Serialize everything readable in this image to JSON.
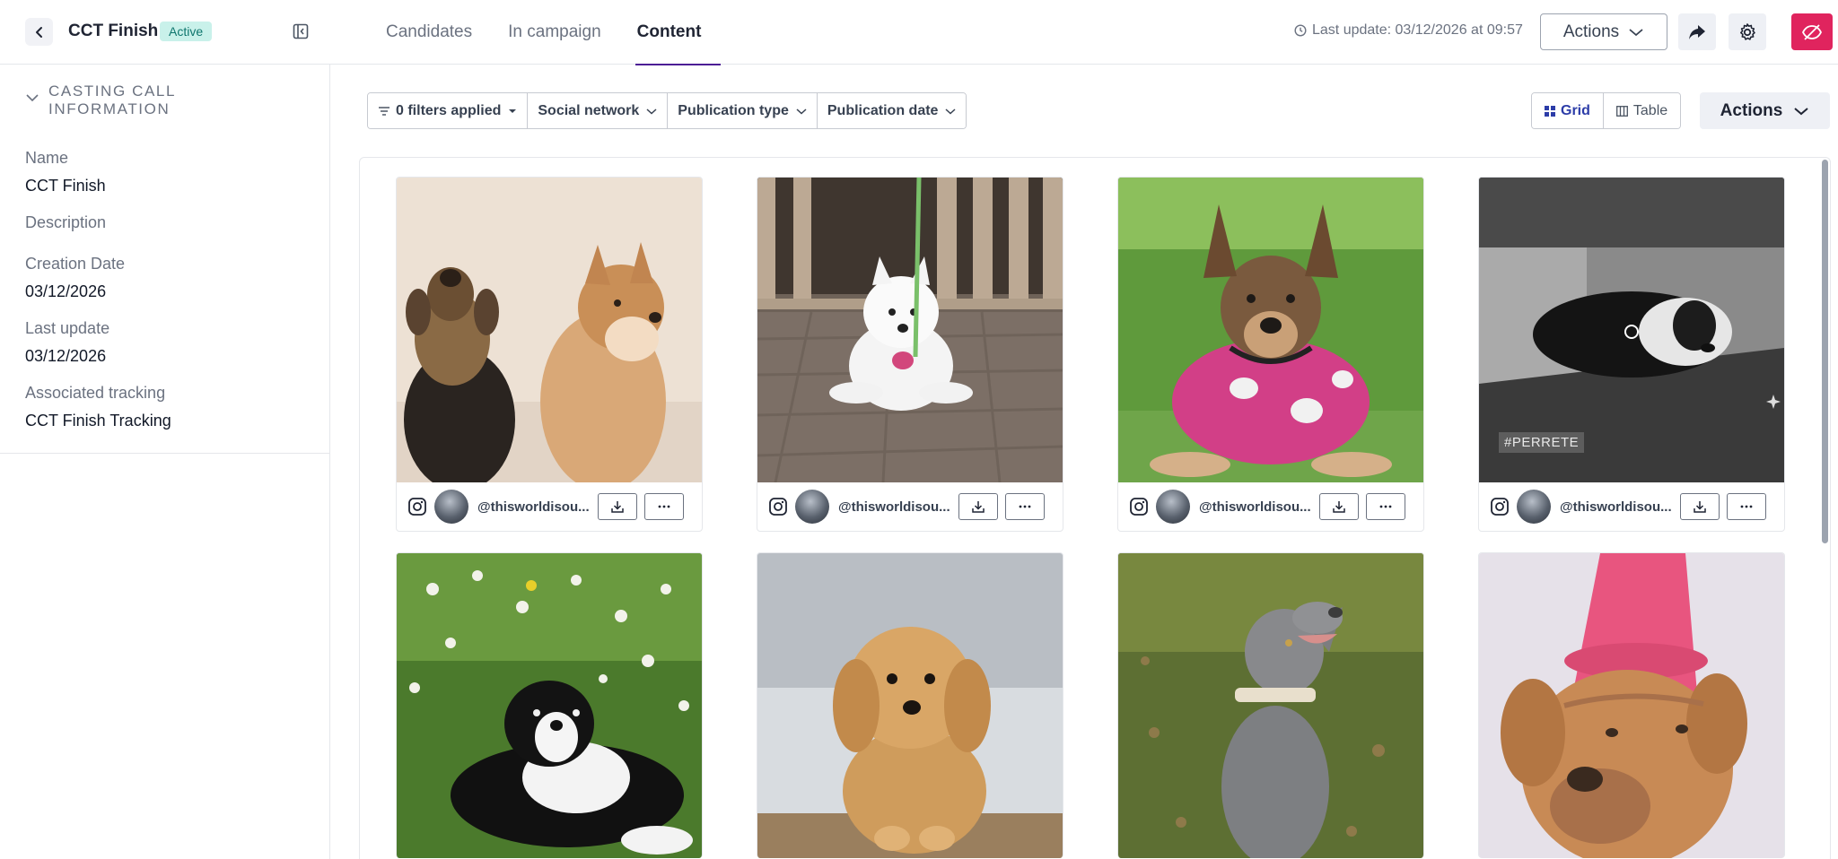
{
  "header": {
    "title": "CCT Finish",
    "status": "Active",
    "tabs": [
      {
        "label": "Candidates"
      },
      {
        "label": "In campaign"
      },
      {
        "label": "Content"
      }
    ],
    "last_update": "Last update: 03/12/2026 at 09:57",
    "actions_label": "Actions",
    "icons": [
      "back-icon",
      "collapse-panel-icon",
      "clock-icon",
      "chevron-down-icon",
      "share-icon",
      "gear-icon",
      "eye-off-icon"
    ],
    "accent_color": "#e0245e"
  },
  "sidebar": {
    "section_title": "CASTING CALL INFORMATION",
    "fields": [
      {
        "label": "Name",
        "value": "CCT Finish"
      },
      {
        "label": "Description",
        "value": ""
      },
      {
        "label": "Creation Date",
        "value": "03/12/2026"
      },
      {
        "label": "Last update",
        "value": "03/12/2026"
      },
      {
        "label": "Associated tracking",
        "value": "CCT Finish Tracking"
      }
    ]
  },
  "toolbar": {
    "filters": [
      "0 filters applied",
      "Social network",
      "Publication type",
      "Publication date"
    ],
    "view_grid": "Grid",
    "view_table": "Table",
    "actions_label": "Actions"
  },
  "content": {
    "cards": [
      {
        "handle": "@thisworldisou...",
        "network": "instagram-icon",
        "image": "two-dogs-photo"
      },
      {
        "handle": "@thisworldisou...",
        "network": "instagram-icon",
        "image": "white-dog-photo"
      },
      {
        "handle": "@thisworldisou...",
        "network": "instagram-icon",
        "image": "dog-pink-shirt-photo"
      },
      {
        "handle": "@thisworldisou...",
        "network": "instagram-icon",
        "image": "sleeping-puppy-video",
        "overlay_text": "#PERRETE"
      },
      {
        "handle": "",
        "network": "instagram-icon",
        "image": "puppy-flowers-photo"
      },
      {
        "handle": "",
        "network": "instagram-icon",
        "image": "fluffy-dog-photo"
      },
      {
        "handle": "",
        "network": "instagram-icon",
        "image": "weimaraner-photo"
      },
      {
        "handle": "",
        "network": "instagram-icon",
        "image": "dog-party-hat-photo"
      }
    ]
  }
}
